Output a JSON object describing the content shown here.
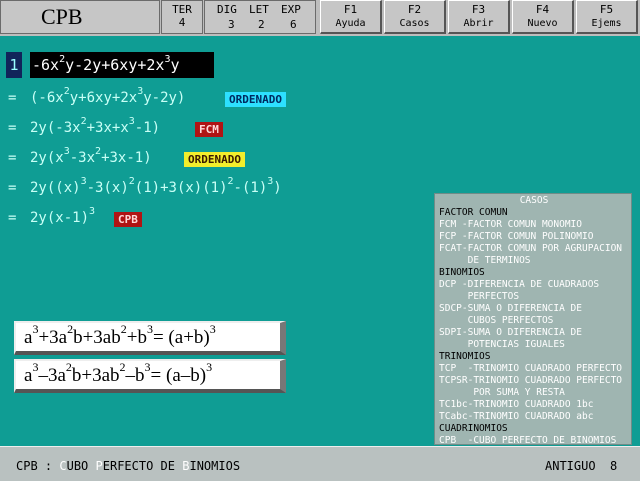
{
  "toolbar": {
    "app_title": "CPB",
    "ter_label": "TER",
    "ter_value": "4",
    "dig_label": "DIG",
    "let_label": "LET",
    "exp_label": "EXP",
    "dig_value": "3",
    "let_value": "2",
    "exp_value": "6",
    "fkeys": [
      {
        "key": "F1",
        "label": "Ayuda"
      },
      {
        "key": "F2",
        "label": "Casos"
      },
      {
        "key": "F3",
        "label": "Abrir"
      },
      {
        "key": "F4",
        "label": "Nuevo"
      },
      {
        "key": "F5",
        "label": "Ejems"
      }
    ]
  },
  "steps": {
    "first_number": "1",
    "equals": "=",
    "tag_ordenado": "ORDENADO",
    "tag_fcm": "FCM",
    "tag_cpb": "CPB"
  },
  "formulas": {
    "cube_sum_result": "= (a+b)",
    "cube_diff_result": "= (a–b)"
  },
  "casos": {
    "title": "CASOS",
    "lines": [
      "FACTOR COMUN",
      "FCM -FACTOR COMUN MONOMIO",
      "FCP -FACTOR COMUN POLINOMIO",
      "FCAT-FACTOR COMUN POR AGRUPACION",
      "     DE TERMINOS",
      "BINOMIOS",
      "DCP -DIFERENCIA DE CUADRADOS",
      "     PERFECTOS",
      "SDCP-SUMA O DIFERENCIA DE",
      "     CUBOS PERFECTOS",
      "SDPI-SUMA O DIFERENCIA DE",
      "     POTENCIAS IGUALES",
      "TRINOMIOS",
      "TCP  -TRINOMIO CUADRADO PERFECTO",
      "TCPSR-TRINOMIO CUADRADO PERFECTO",
      "      POR SUMA Y RESTA",
      "TC1bc-TRINOMIO CUADRADO 1bc",
      "TCabc-TRINOMIO CUADRADO abc",
      "CUADRINOMIOS",
      "CPB  -CUBO PERFECTO DE BINOMIOS"
    ],
    "headers": [
      0,
      5,
      12,
      18
    ]
  },
  "status": {
    "code": "CPB",
    "sep": " : ",
    "c1": "C",
    "r1": "UBO ",
    "c2": "P",
    "r2": "ERFECTO DE ",
    "c3": "B",
    "r3": "INOMIOS",
    "mode": "ANTIGUO",
    "number": "8"
  },
  "colors": {
    "background": "#0f9d94",
    "toolbar": "#c6c6c6",
    "ordenado_tag": "#2de0ff",
    "ordenado_tag_2": "#f3ee2c",
    "red_tag": "#b01414",
    "casos_panel": "#9fb5b1"
  }
}
